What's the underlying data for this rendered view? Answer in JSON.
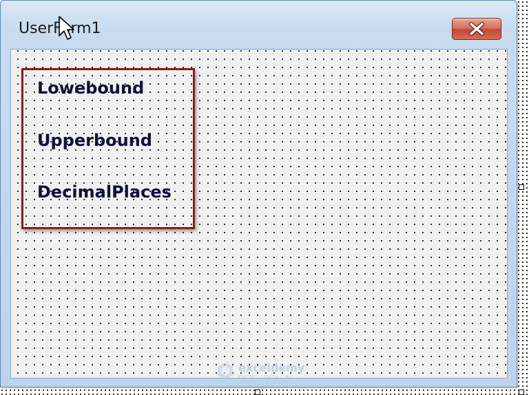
{
  "window": {
    "title": "UserForm1"
  },
  "form": {
    "labels": [
      {
        "text": "Lowebound"
      },
      {
        "text": "Upperbound"
      },
      {
        "text": "DecimalPlaces"
      }
    ]
  },
  "watermark": {
    "name": "exceldemy",
    "tagline": "EXCEL · DATA · BI",
    "icon": "exceldemy-logo-icon"
  },
  "icons": {
    "close": "close-icon",
    "cursor": "mouse-cursor-icon"
  },
  "colors": {
    "highlight_border": "#8b1a1a",
    "close_button": "#c24a36",
    "label_text": "#0f0f3a"
  }
}
